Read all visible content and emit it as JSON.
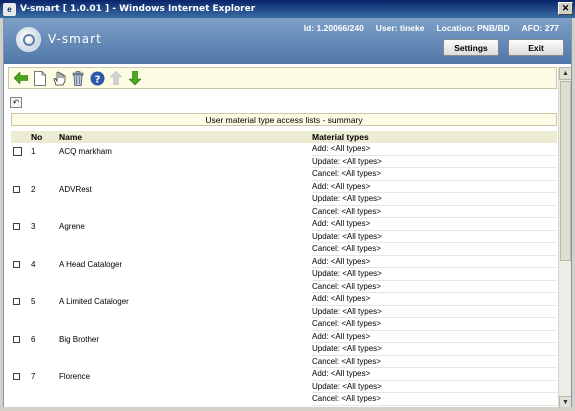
{
  "window": {
    "title": "V-smart [ 1.0.01 ] - Windows Internet Explorer",
    "close_glyph": "✕"
  },
  "header": {
    "logo_text": "V-smart",
    "id": "Id: 1.20066/240",
    "user": "User: tineke",
    "location": "Location: PNB/BD",
    "afo": "AFO: 277",
    "settings_label": "Settings",
    "exit_label": "Exit"
  },
  "toolbar": {
    "icons": [
      "back-arrow-icon",
      "new-document-icon",
      "hand-select-icon",
      "trash-icon",
      "help-icon",
      "arrow-up-icon",
      "arrow-down-icon"
    ],
    "colors": {
      "arrow": "#4aa81e",
      "help": "#2a5aa8",
      "disabled": "#c8c8c8"
    }
  },
  "undo_glyph": "↶",
  "caption": "User material type access lists - summary",
  "columns": {
    "no": "No",
    "name": "Name",
    "material_types": "Material types"
  },
  "rows": [
    {
      "no": "1",
      "name": "ACQ markham",
      "add": "Add: <All types>",
      "update": "Update: <All types>",
      "cancel": "Cancel: <All types>"
    },
    {
      "no": "2",
      "name": "ADVRest",
      "add": "Add: <All types>",
      "update": "Update: <All types>",
      "cancel": "Cancel: <All types>"
    },
    {
      "no": "3",
      "name": "Agrene",
      "add": "Add: <All types>",
      "update": "Update: <All types>",
      "cancel": "Cancel: <All types>"
    },
    {
      "no": "4",
      "name": "A Head Cataloger",
      "add": "Add: <All types>",
      "update": "Update: <All types>",
      "cancel": "Cancel: <All types>"
    },
    {
      "no": "5",
      "name": "A Limited Cataloger",
      "add": "Add: <All types>",
      "update": "Update: <All types>",
      "cancel": "Cancel: <All types>"
    },
    {
      "no": "6",
      "name": "Big Brother",
      "add": "Add: <All types>",
      "update": "Update: <All types>",
      "cancel": "Cancel: <All types>"
    },
    {
      "no": "7",
      "name": "Florence",
      "add": "Add: <All types>",
      "update": "Update: <All types>",
      "cancel": "Cancel: <All types>"
    }
  ]
}
